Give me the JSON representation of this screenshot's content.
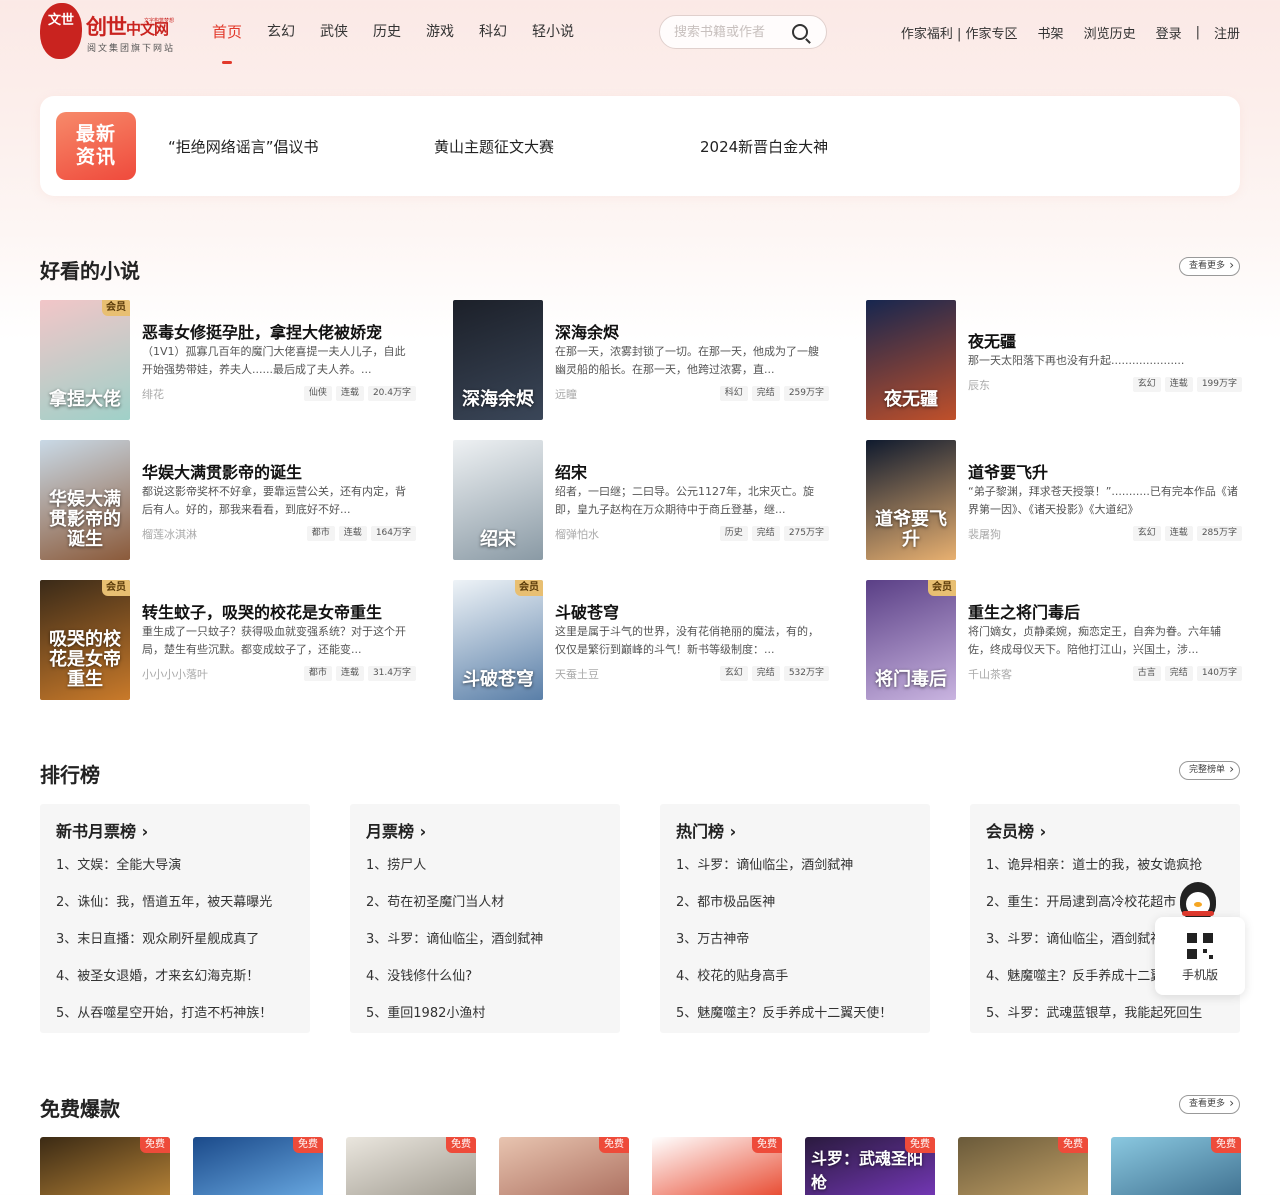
{
  "logo": {
    "circle_text": "文世",
    "brand": "创世",
    "brand_suffix": "中文网",
    "tagline": "文字构筑梦想",
    "subtitle": "阅文集团旗下网站"
  },
  "nav": {
    "items": [
      "首页",
      "玄幻",
      "武侠",
      "历史",
      "游戏",
      "科幻",
      "轻小说"
    ],
    "active": "首页"
  },
  "search": {
    "placeholder": "搜索书籍或作者"
  },
  "top_links": {
    "author_welfare": "作家福利 | 作家专区",
    "bookshelf": "书架",
    "history": "浏览历史",
    "login": "登录",
    "separator": "|",
    "register": "注册"
  },
  "news": {
    "badge": "最新资讯",
    "badge_line1": "最新",
    "badge_line2": "资讯",
    "items": [
      "“拒绝网络谣言”倡议书",
      "黄山主题征文大赛",
      "2024新晋白金大神"
    ]
  },
  "good_novels": {
    "title": "好看的小说",
    "more": "查看更多",
    "books": [
      {
        "title": "恶毒女修挺孕肚，拿捏大佬被娇宠",
        "desc": "（1V1）孤寡几百年的魔门大佬喜提一夫人儿子，自此开始强势带娃，养夫人......最后成了夫人养。...",
        "author": "绯花",
        "genre": "仙侠",
        "status": "连载",
        "words": "20.4万字",
        "vip": "会员",
        "cover_text": "拿捏大佬",
        "cover_color1": "#f2c6c8",
        "cover_color2": "#9fd0c8"
      },
      {
        "title": "深海余烬",
        "desc": "在那一天，浓雾封锁了一切。在那一天，他成为了一艘幽灵船的船长。在那一天，他跨过浓雾，直...",
        "author": "远瞳",
        "genre": "科幻",
        "status": "完结",
        "words": "259万字",
        "vip": "",
        "cover_text": "深海余烬",
        "cover_color1": "#1c2029",
        "cover_color2": "#3a4658"
      },
      {
        "title": "夜无疆",
        "desc": "那一天太阳落下再也没有升起.....................",
        "author": "辰东",
        "genre": "玄幻",
        "status": "连载",
        "words": "199万字",
        "vip": "",
        "cover_text": "夜无疆",
        "cover_color1": "#16264f",
        "cover_color2": "#c0502a"
      },
      {
        "title": "华娱大满贯影帝的诞生",
        "desc": "都说这影帝奖杯不好拿，要靠运营公关，还有内定，背后有人。好的，那我来看看，到底好不好...",
        "author": "榴莲冰淇淋",
        "genre": "都市",
        "status": "连载",
        "words": "164万字",
        "vip": "",
        "cover_text": "华娱大满贯影帝的诞生",
        "cover_color1": "#c9d9e6",
        "cover_color2": "#8b5a3a"
      },
      {
        "title": "绍宋",
        "desc": "绍者，一曰继；二曰导。公元1127年，北宋灭亡。旋即，皇九子赵构在万众期待中于商丘登基，继...",
        "author": "榴弹怕水",
        "genre": "历史",
        "status": "完结",
        "words": "275万字",
        "vip": "",
        "cover_text": "绍宋",
        "cover_color1": "#eef1f3",
        "cover_color2": "#8a9aa5"
      },
      {
        "title": "道爷要飞升",
        "desc": "“弟子黎渊，拜求苍天授箓！”...........已有完本作品《诸界第一因》、《诸天投影》《大道纪》",
        "author": "裴屠狗",
        "genre": "玄幻",
        "status": "连载",
        "words": "285万字",
        "vip": "",
        "cover_text": "道爷要飞升",
        "cover_color1": "#0f1a2e",
        "cover_color2": "#e8b070"
      },
      {
        "title": "转生蚊子，吸哭的校花是女帝重生",
        "desc": "重生成了一只蚊子？获得吸血就变强系统？对于这个开局，楚生有些沉默。都变成蚊子了，还能变...",
        "author": "小小小小落叶",
        "genre": "都市",
        "status": "连载",
        "words": "31.4万字",
        "vip": "会员",
        "cover_text": "吸哭的校花是女帝重生",
        "cover_color1": "#3a2a18",
        "cover_color2": "#c97a2a"
      },
      {
        "title": "斗破苍穹",
        "desc": "这里是属于斗气的世界，没有花俏艳丽的魔法，有的，仅仅是繁衍到巅峰的斗气！新书等级制度：...",
        "author": "天蚕土豆",
        "genre": "玄幻",
        "status": "完结",
        "words": "532万字",
        "vip": "会员",
        "cover_text": "斗破苍穹",
        "cover_color1": "#eef3f7",
        "cover_color2": "#5a7fa8"
      },
      {
        "title": "重生之将门毒后",
        "desc": "将门嫡女，贞静柔婉，痴恋定王，自奔为眷。六年辅佐，终成母仪天下。陪他打江山，兴国土，涉...",
        "author": "千山茶客",
        "genre": "古言",
        "status": "完结",
        "words": "140万字",
        "vip": "会员",
        "cover_text": "将门毒后",
        "cover_color1": "#5a3f86",
        "cover_color2": "#c9b4e0"
      }
    ]
  },
  "ranking": {
    "title": "排行榜",
    "more": "完整榜单",
    "boards": [
      {
        "title": "新书月票榜",
        "items": [
          "1、文娱：全能大导演",
          "2、诛仙：我，悟道五年，被天幕曝光",
          "3、末日直播：观众刷歼星舰成真了",
          "4、被圣女退婚，才来玄幻海克斯！",
          "5、从吞噬星空开始，打造不朽神族！"
        ]
      },
      {
        "title": "月票榜",
        "items": [
          "1、捞尸人",
          "2、苟在初圣魔门当人材",
          "3、斗罗：谪仙临尘，酒剑弑神",
          "4、没钱修什么仙?",
          "5、重回1982小渔村"
        ]
      },
      {
        "title": "热门榜",
        "items": [
          "1、斗罗：谪仙临尘，酒剑弑神",
          "2、都市极品医神",
          "3、万古神帝",
          "4、校花的贴身高手",
          "5、魅魔噬主？反手养成十二翼天使！"
        ]
      },
      {
        "title": "会员榜",
        "items": [
          "1、诡异相亲：道士的我，被女诡疯抢",
          "2、重生：开局逮到高冷校花超市",
          "3、斗罗：谪仙临尘，酒剑弑神",
          "4、魅魔噬主？反手养成十二翼天使！",
          "5、斗罗：武魂蓝银草，我能起死回生"
        ]
      }
    ]
  },
  "float_widget": {
    "label": "手机版"
  },
  "free": {
    "title": "免费爆款",
    "more": "查看更多",
    "tag": "免费",
    "covers": [
      {
        "text": "",
        "c1": "#3b2a14",
        "c2": "#c08a3a"
      },
      {
        "text": "",
        "c1": "#1b4a8a",
        "c2": "#6fb0e8"
      },
      {
        "text": "",
        "c1": "#eae6de",
        "c2": "#9a958a"
      },
      {
        "text": "",
        "c1": "#e8c4b0",
        "c2": "#a86a5a"
      },
      {
        "text": "",
        "c1": "#ffffff",
        "c2": "#e63a1e"
      },
      {
        "text": "斗罗：武魂圣阳枪",
        "c1": "#2a1a3e",
        "c2": "#7a3ac0"
      },
      {
        "text": "",
        "c1": "#6a5a3a",
        "c2": "#c9a66a"
      },
      {
        "text": "",
        "c1": "#8ac8e0",
        "c2": "#3a6a8a"
      }
    ]
  }
}
